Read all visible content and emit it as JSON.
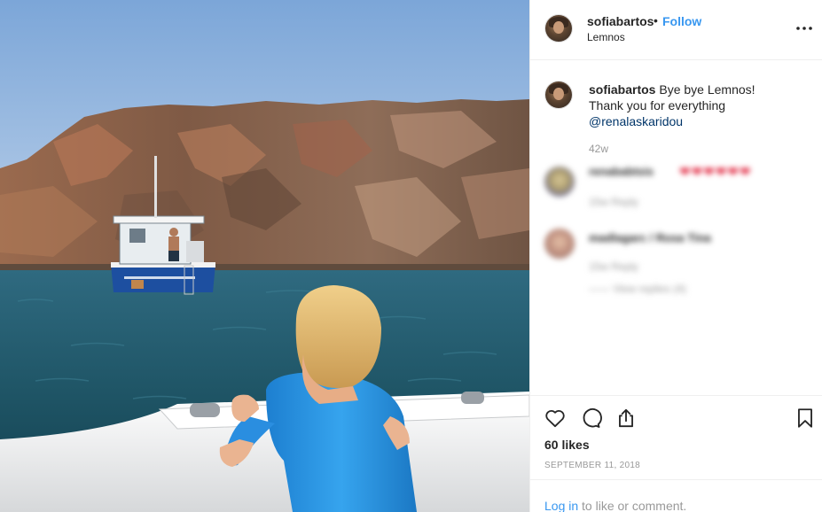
{
  "post": {
    "username": "sofiabartos",
    "separator": "•",
    "follow_label": "Follow",
    "location": "Lemnos",
    "more_icon": "more-horizontal-icon"
  },
  "caption": {
    "username": "sofiabartos",
    "line1": "Bye bye Lemnos!",
    "line2": "Thank you for everything",
    "mention": "@renalaskaridou",
    "age": "42w"
  },
  "comments": [
    {
      "username": "renababtsis",
      "text": "❤❤❤❤❤❤",
      "meta": "15w Reply"
    },
    {
      "username": "madlagarc / Rosa Tina",
      "meta": "15w Reply",
      "replies": "—— View replies (4)"
    }
  ],
  "actions": {
    "like_icon": "heart-icon",
    "comment_icon": "comment-icon",
    "share_icon": "share-icon",
    "save_icon": "bookmark-icon",
    "likes": "60 likes",
    "date": "SEPTEMBER 11, 2018"
  },
  "login": {
    "link": "Log in",
    "rest": " to like or comment."
  },
  "colors": {
    "accent": "#3897f0",
    "mention": "#003569",
    "text": "#262626",
    "muted": "#999999",
    "divider": "#efefef"
  }
}
